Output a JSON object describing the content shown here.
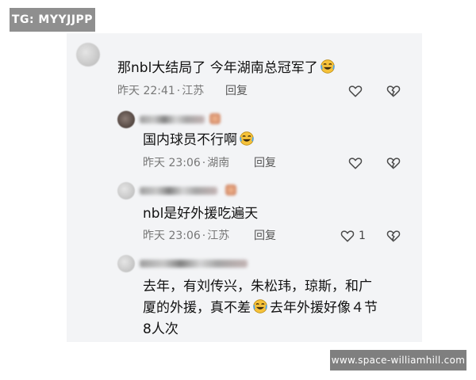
{
  "tag": "TG: MYYJJPP",
  "watermark": "www.space-williamhill.com",
  "comments": [
    {
      "text": "那nbl大结局了 今年湖南总冠军了",
      "time": "昨天 22:41",
      "location": "江苏",
      "reply_label": "回复",
      "emoji": "laughing-crying-emoji",
      "like_count": ""
    },
    {
      "text": "国内球员不行啊",
      "time": "昨天 23:06",
      "location": "湖南",
      "reply_label": "回复",
      "emoji": "laughing-crying-emoji",
      "like_count": ""
    },
    {
      "text": "nbl是好外援吃遍天",
      "time": "昨天 23:06",
      "location": "江苏",
      "reply_label": "回复",
      "emoji": "",
      "like_count": "1"
    },
    {
      "text_line1": "去年，有刘传兴，朱松玮，琼斯，和广",
      "text_line2a": "厦的外援，真不差",
      "text_line2b": "去年外援好像４节",
      "text_line3": "8人次",
      "emoji": "laughing-crying-emoji"
    }
  ],
  "colors": {
    "panel_bg": "#f3f4f6",
    "badge_bg": "#8f8f8f",
    "text": "#111111",
    "meta": "#777777",
    "icon": "#4a4a4a"
  }
}
